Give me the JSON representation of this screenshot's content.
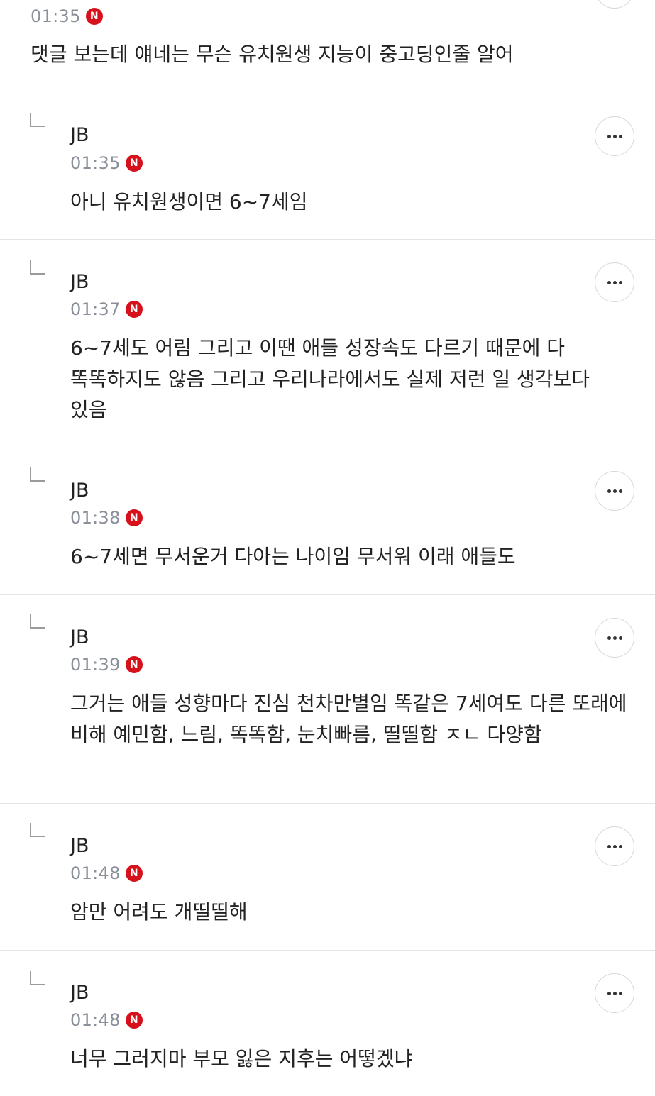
{
  "colors": {
    "new_badge": "#d6111c",
    "time_text": "#8a8f99",
    "divider": "#e4e4e4",
    "text": "#222222"
  },
  "badge_label": "N",
  "more_icon": "ellipsis-icon",
  "comments": [
    {
      "time": "01:35",
      "text": "댓글 보는데 얘네는 무슨 유치원생 지능이 중고딩인줄 알어"
    },
    {
      "author": "JB",
      "time": "01:35",
      "text": "아니 유치원생이면 6~7세임"
    },
    {
      "author": "JB",
      "time": "01:37",
      "text": "6~7세도 어림 그리고 이땐 애들 성장속도 다르기 때문에 다 똑똑하지도 않음 그리고 우리나라에서도 실제 저런 일 생각보다 있음"
    },
    {
      "author": "JB",
      "time": "01:38",
      "text": "6~7세면 무서운거 다아는 나이임 무서워 이래 애들도"
    },
    {
      "author": "JB",
      "time": "01:39",
      "text": "그거는 애들 성향마다 진심 천차만별임 똑같은 7세여도 다른 또래에 비해 예민함, 느림, 똑똑함, 눈치빠름, 띨띨함 ㅈㄴ 다양함"
    },
    {
      "author": "JB",
      "time": "01:48",
      "text": "암만 어려도 개띨띨해"
    },
    {
      "author": "JB",
      "time": "01:48",
      "text": "너무 그러지마 부모 잃은 지후는 어떻겠냐"
    }
  ]
}
